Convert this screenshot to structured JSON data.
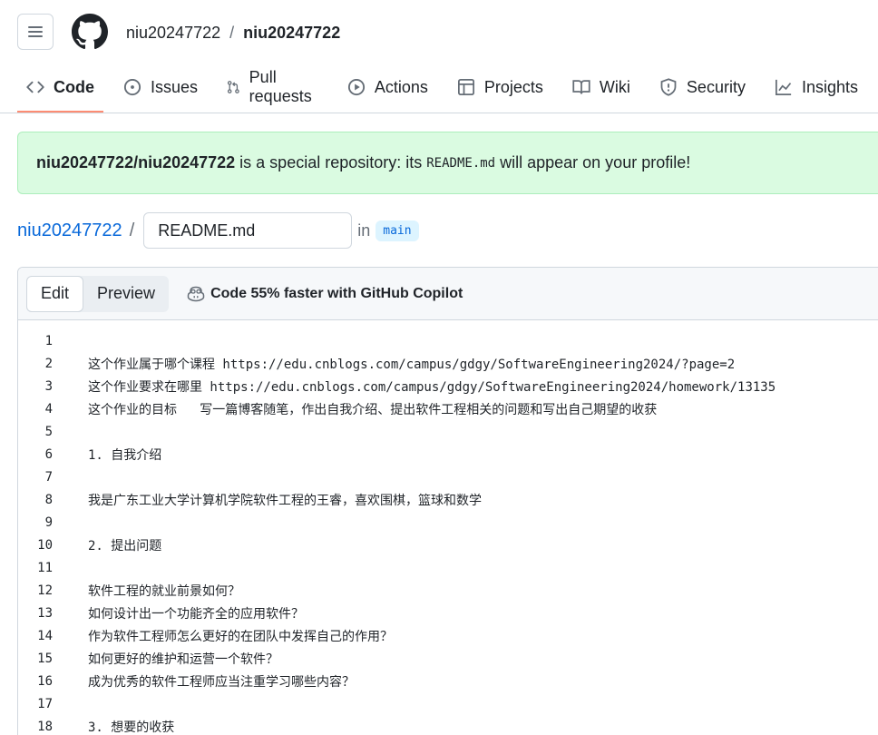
{
  "header": {
    "owner": "niu20247722",
    "separator": "/",
    "repo": "niu20247722"
  },
  "nav": [
    {
      "label": "Code",
      "icon": "code-icon"
    },
    {
      "label": "Issues",
      "icon": "issue-icon"
    },
    {
      "label": "Pull requests",
      "icon": "pull-request-icon"
    },
    {
      "label": "Actions",
      "icon": "play-icon"
    },
    {
      "label": "Projects",
      "icon": "table-icon"
    },
    {
      "label": "Wiki",
      "icon": "book-icon"
    },
    {
      "label": "Security",
      "icon": "shield-icon"
    },
    {
      "label": "Insights",
      "icon": "graph-icon"
    }
  ],
  "banner": {
    "repo_full": "niu20247722/niu20247722",
    "text_before": "is a special repository: its",
    "code": "README.md",
    "text_after": "will appear on your profile!"
  },
  "path": {
    "owner": "niu20247722",
    "slash": "/",
    "filename": "README.md",
    "in_label": "in",
    "branch": "main"
  },
  "editor": {
    "tab_edit": "Edit",
    "tab_preview": "Preview",
    "copilot_label": "Code 55% faster with GitHub Copilot"
  },
  "lines": [
    {
      "n": "1",
      "t": ""
    },
    {
      "n": "2",
      "t": "这个作业属于哪个课程 https://edu.cnblogs.com/campus/gdgy/SoftwareEngineering2024/?page=2"
    },
    {
      "n": "3",
      "t": "这个作业要求在哪里 https://edu.cnblogs.com/campus/gdgy/SoftwareEngineering2024/homework/13135"
    },
    {
      "n": "4",
      "t": "这个作业的目标   写一篇博客随笔，作出自我介绍、提出软件工程相关的问题和写出自己期望的收获"
    },
    {
      "n": "5",
      "t": ""
    },
    {
      "n": "6",
      "t": "1. 自我介绍"
    },
    {
      "n": "7",
      "t": ""
    },
    {
      "n": "8",
      "t": "我是广东工业大学计算机学院软件工程的王睿，喜欢围棋，篮球和数学"
    },
    {
      "n": "9",
      "t": ""
    },
    {
      "n": "10",
      "t": "2. 提出问题"
    },
    {
      "n": "11",
      "t": ""
    },
    {
      "n": "12",
      "t": "软件工程的就业前景如何？"
    },
    {
      "n": "13",
      "t": "如何设计出一个功能齐全的应用软件？"
    },
    {
      "n": "14",
      "t": "作为软件工程师怎么更好的在团队中发挥自己的作用？"
    },
    {
      "n": "15",
      "t": "如何更好的维护和运营一个软件？"
    },
    {
      "n": "16",
      "t": "成为优秀的软件工程师应当注重学习哪些内容？"
    },
    {
      "n": "17",
      "t": ""
    },
    {
      "n": "18",
      "t": "3. 想要的收获"
    }
  ]
}
